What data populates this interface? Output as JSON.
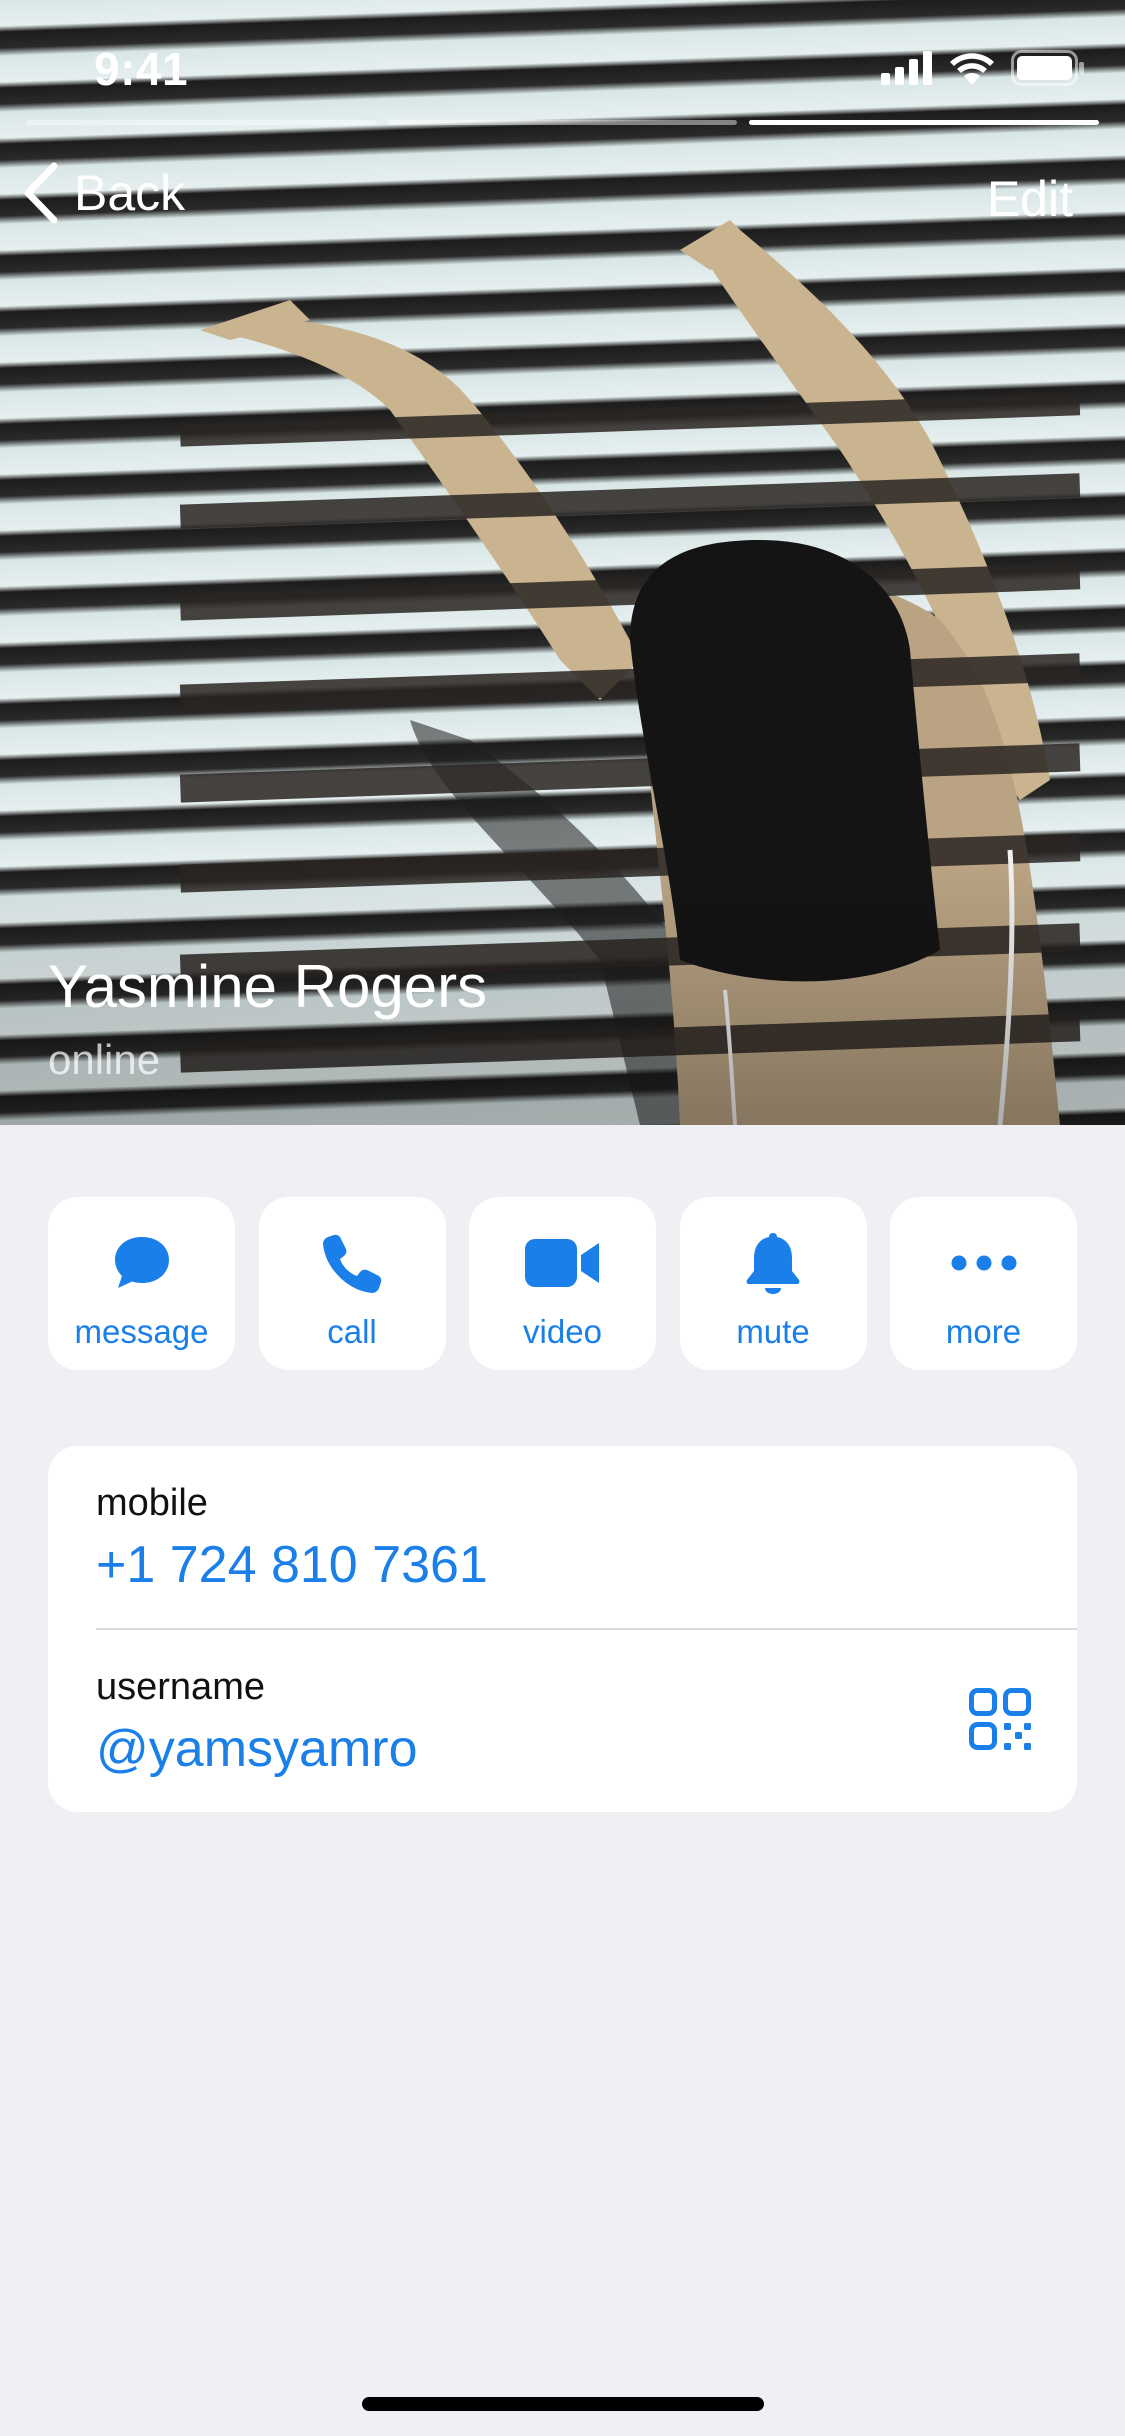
{
  "status_bar": {
    "time": "9:41"
  },
  "story": {
    "segments": 3,
    "active_index": 2
  },
  "nav": {
    "back_label": "Back",
    "edit_label": "Edit"
  },
  "contact": {
    "name": "Yasmine Rogers",
    "status": "online"
  },
  "actions": [
    {
      "label": "message",
      "icon": "chat-bubble-icon"
    },
    {
      "label": "call",
      "icon": "phone-icon"
    },
    {
      "label": "video",
      "icon": "video-camera-icon"
    },
    {
      "label": "mute",
      "icon": "bell-icon"
    },
    {
      "label": "more",
      "icon": "ellipsis-icon"
    }
  ],
  "info": {
    "mobile_label": "mobile",
    "mobile_value": "+1 724 810 7361",
    "username_label": "username",
    "username_value": "@yamsyamro"
  },
  "colors": {
    "accent": "#1a7fe8",
    "background": "#efeff4",
    "card": "#ffffff"
  }
}
